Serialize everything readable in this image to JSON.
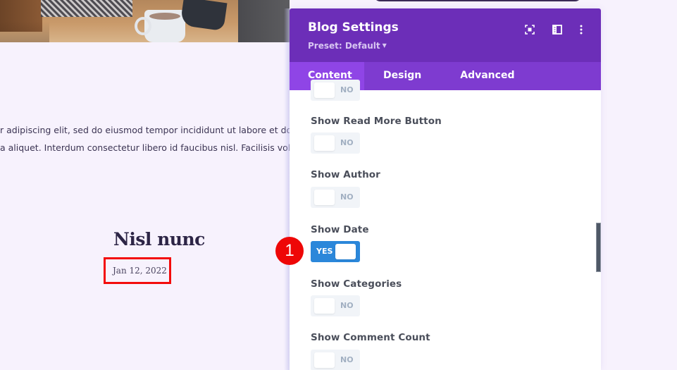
{
  "background_page": {
    "body_text_lines": [
      "r adipiscing elit, sed do eiusmod tempor incididunt ut labore et dolore",
      "a aliquet. Interdum consectetur libero id faucibus nisl. Facilisis volutpa"
    ],
    "post_title": "Nisl nunc",
    "post_date": "Jan 12, 2022",
    "highlight_color": "#f30c0c"
  },
  "panel": {
    "title": "Blog Settings",
    "preset": "Preset: Default",
    "header_color": "#6c2eb8",
    "icons": [
      "focus-mode-icon",
      "sidebar-layout-icon",
      "more-options-icon"
    ],
    "tabs": [
      {
        "label": "Content",
        "active": true
      },
      {
        "label": "Design",
        "active": false
      },
      {
        "label": "Advanced",
        "active": false
      }
    ],
    "fields": [
      {
        "label": "",
        "value": "NO",
        "on": false
      },
      {
        "label": "Show Read More Button",
        "value": "NO",
        "on": false
      },
      {
        "label": "Show Author",
        "value": "NO",
        "on": false
      },
      {
        "label": "Show Date",
        "value": "YES",
        "on": true
      },
      {
        "label": "Show Categories",
        "value": "NO",
        "on": false
      },
      {
        "label": "Show Comment Count",
        "value": "NO",
        "on": false
      }
    ],
    "toggle_on_color": "#2b87da"
  },
  "annotation": {
    "step_number": "1",
    "color": "#ee0707"
  }
}
